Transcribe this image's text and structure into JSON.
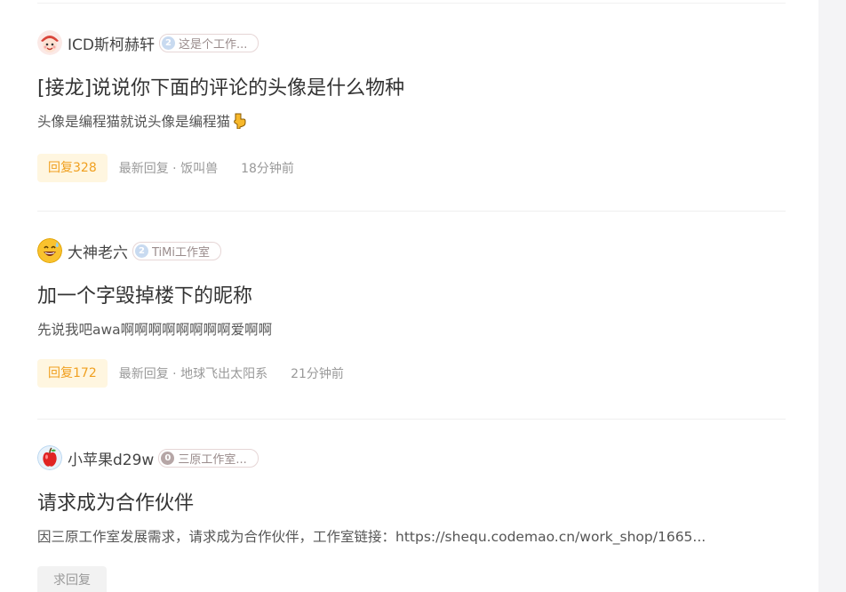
{
  "posts": [
    {
      "author": "ICD斯柯赫轩",
      "badge_level": "2",
      "badge_text": "这是个工作...",
      "avatar_icon": "cartoon-character-avatar",
      "title": "[接龙]说说你下面的评论的头像是什么物种",
      "body": "头像是编程猫就说头像是编程猫",
      "body_emoji": "pointing-down-hand-emoji",
      "reply_label": "回复328",
      "latest_reply": "最新回复 · 饭叫兽",
      "time": "18分钟前"
    },
    {
      "author": "大神老六",
      "badge_level": "2",
      "badge_text": "TiMi工作室",
      "avatar_icon": "grinning-sweat-emoji-avatar",
      "title": "加一个字毁掉楼下的昵称",
      "body": "先说我吧awa啊啊啊啊啊啊啊啊爱啊啊",
      "reply_label": "回复172",
      "latest_reply": "最新回复 · 地球飞出太阳系",
      "time": "21分钟前"
    },
    {
      "author": "小苹果d29w",
      "badge_level": "0",
      "badge_text": "三原工作室...",
      "avatar_icon": "apple-avatar",
      "title": "请求成为合作伙伴",
      "body": "因三原工作室发展需求，请求成为合作伙伴，工作室链接：https://shequ.codemao.cn/work_shop/1665...",
      "reply_label": "求回复"
    }
  ],
  "colors": {
    "reply_bg": "#fff6e0",
    "reply_text": "#f0a020",
    "page_bg": "#f4f4f6"
  }
}
